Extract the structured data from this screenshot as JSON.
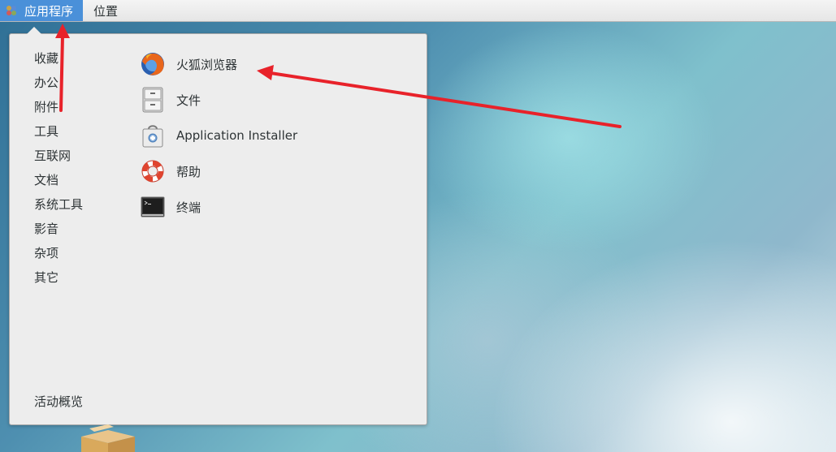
{
  "topbar": {
    "applications_label": "应用程序",
    "places_label": "位置"
  },
  "menu": {
    "categories": [
      {
        "label": "收藏"
      },
      {
        "label": "办公"
      },
      {
        "label": "附件"
      },
      {
        "label": "工具"
      },
      {
        "label": "互联网"
      },
      {
        "label": "文档"
      },
      {
        "label": "系统工具"
      },
      {
        "label": "影音"
      },
      {
        "label": "杂项"
      },
      {
        "label": "其它"
      }
    ],
    "activities_label": "活动概览",
    "apps": [
      {
        "label": "火狐浏览器",
        "icon": "firefox-icon"
      },
      {
        "label": "文件",
        "icon": "file-cabinet-icon"
      },
      {
        "label": "Application Installer",
        "icon": "software-bag-icon"
      },
      {
        "label": "帮助",
        "icon": "lifebuoy-icon"
      },
      {
        "label": "终端",
        "icon": "terminal-icon"
      }
    ]
  },
  "colors": {
    "active_highlight": "#4a90d9",
    "annotation_arrow": "#e8222a",
    "menu_background": "#ededed"
  }
}
